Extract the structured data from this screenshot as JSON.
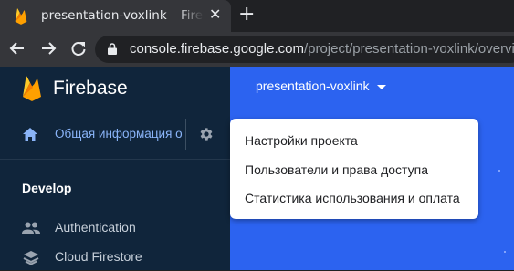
{
  "browser": {
    "tab": {
      "title": "presentation-voxlink – Firebase",
      "close_icon": "close-icon"
    },
    "new_tab_icon": "plus-icon",
    "address": {
      "host": "console.firebase.google.com",
      "path": "/project/presentation-voxlink/overview"
    }
  },
  "sidebar": {
    "brand": "Firebase",
    "overview_label": "Общая информация о проекте",
    "section_title": "Develop",
    "items": [
      {
        "label": "Authentication",
        "icon": "people-icon"
      },
      {
        "label": "Cloud Firestore",
        "icon": "firestore-icon"
      }
    ]
  },
  "header": {
    "project_name": "presentation-voxlink"
  },
  "settings_menu": {
    "items": [
      "Настройки проекта",
      "Пользователи и права доступа",
      "Статистика использования и оплата"
    ]
  },
  "colors": {
    "sidebar_bg": "#10253b",
    "main_bg": "#2c63f0",
    "accent_link": "#8ab4f8",
    "firebase_orange": "#ffa000",
    "firebase_yellow": "#ffca28"
  }
}
